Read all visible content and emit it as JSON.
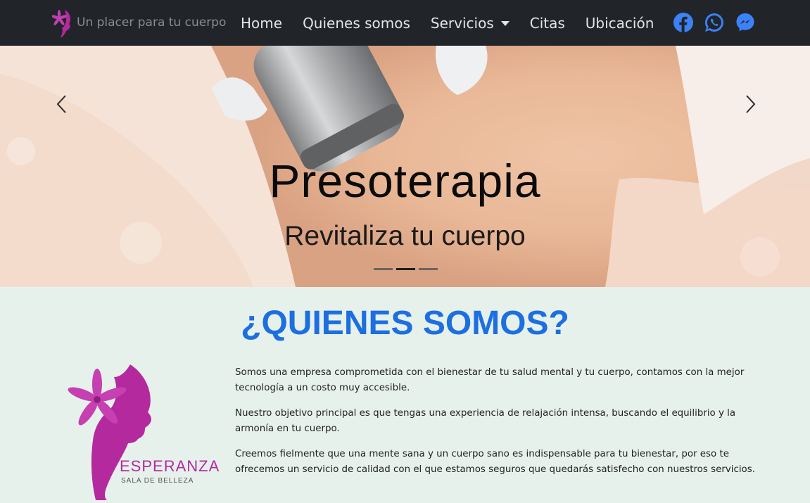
{
  "navbar": {
    "brand_text": "Un placer para tu cuerpo",
    "links": [
      {
        "label": "Home"
      },
      {
        "label": "Quienes somos"
      },
      {
        "label": "Servicios"
      },
      {
        "label": "Citas"
      },
      {
        "label": "Ubicación"
      }
    ],
    "social_icons": [
      "facebook-icon",
      "whatsapp-icon",
      "messenger-icon"
    ],
    "social_color": "#3b82f6"
  },
  "hero": {
    "title": "Presoterapia",
    "subtitle": "Revitaliza tu cuerpo",
    "slide_count": 3,
    "active_slide": 2
  },
  "about": {
    "title": "¿QUIENES SOMOS?",
    "title_color": "#1d6fe0",
    "paragraphs": [
      "Somos una empresa comprometida con el bienestar de tu salud mental y tu cuerpo, contamos con la mejor tecnología a un costo muy accesible.",
      "Nuestro objetivo principal es que tengas una experiencia de relajación intensa, buscando el equilibrio y la armonía en tu cuerpo.",
      "Creemos fielmente que una mente sana y un cuerpo sano es indispensable para tu bienestar, por eso te ofrecemos un servicio de calidad con el que estamos seguros que quedarás satisfecho con nuestros servicios."
    ],
    "logo": {
      "name": "ESPERANZA",
      "tagline": "SALA DE BELLEZA",
      "color": "#b5299f"
    }
  }
}
